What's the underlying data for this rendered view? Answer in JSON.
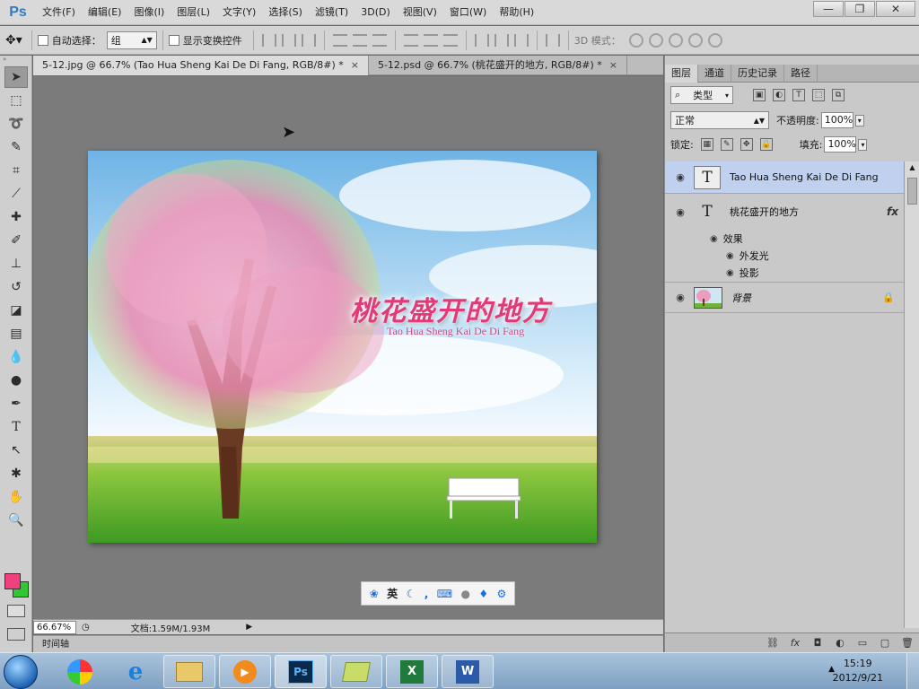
{
  "app": {
    "logo": "Ps"
  },
  "menu": [
    "文件(F)",
    "编辑(E)",
    "图像(I)",
    "图层(L)",
    "文字(Y)",
    "选择(S)",
    "滤镜(T)",
    "3D(D)",
    "视图(V)",
    "窗口(W)",
    "帮助(H)"
  ],
  "window_controls": {
    "minimize": "—",
    "restore": "❐",
    "close": "✕"
  },
  "options": {
    "auto_select_label": "自动选择：",
    "auto_select_value": "组",
    "show_transform_label": "显示变换控件",
    "mode3d_label": "3D 模式："
  },
  "tabs": [
    {
      "label": "5-12.jpg @ 66.7% (Tao Hua Sheng Kai De Di Fang, RGB/8#) *",
      "close": "×"
    },
    {
      "label": "5-12.psd @ 66.7% (桃花盛开的地方, RGB/8#) *",
      "close": "×"
    }
  ],
  "artwork": {
    "title": "桃花盛开的地方",
    "subtitle": "Tao Hua Sheng Kai De Di Fang"
  },
  "ime": {
    "lang": "英"
  },
  "status": {
    "zoom": "66.67%",
    "doc": "文档:1.59M/1.93M"
  },
  "timeline_label": "时间轴",
  "panels": {
    "tabs": [
      "图层",
      "通道",
      "历史记录",
      "路径"
    ],
    "filter_kind": "类型",
    "blend_mode": "正常",
    "opacity_label": "不透明度:",
    "opacity_value": "100%",
    "lock_label": "锁定:",
    "fill_label": "填充:",
    "fill_value": "100%"
  },
  "layers": [
    {
      "name": "Tao Hua Sheng Kai De Di Fang",
      "kind": "text",
      "selected": true
    },
    {
      "name": "桃花盛开的地方",
      "kind": "text",
      "fx": "fx"
    },
    {
      "name": "背景",
      "kind": "image",
      "locked": true
    }
  ],
  "effects": {
    "group": "效果",
    "items": [
      "外发光",
      "投影"
    ]
  },
  "taskbar": {
    "time": "15:19",
    "date": "2012/9/21"
  },
  "colors": {
    "foreground": "#f0407d",
    "background": "#30c830",
    "accent": "#2d7bc4"
  }
}
